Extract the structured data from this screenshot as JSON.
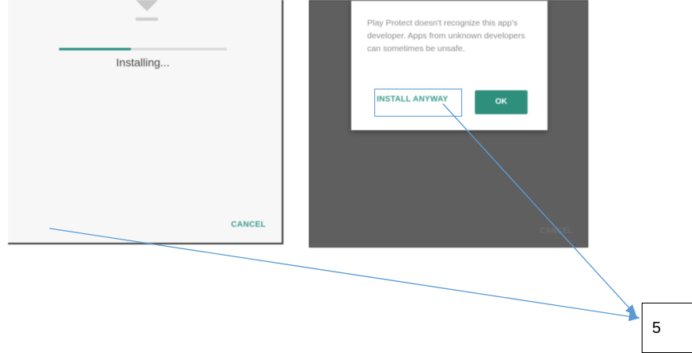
{
  "installing_screen": {
    "status_label": "Installing...",
    "progress_fraction": 0.43,
    "cancel_label": "CANCEL",
    "icon": "download-arrow-icon"
  },
  "play_protect_dialog": {
    "message": "Play Protect doesn't recognize this app's developer. Apps from unknown developers can sometimes be unsafe.",
    "install_anyway_label": "INSTALL ANYWAY",
    "ok_label": "OK",
    "background_cancel_label": "CANCEL"
  },
  "annotation": {
    "step_number": "5",
    "highlight_color": "#5b9bd5",
    "arrow_color": "#5b9bd5"
  },
  "colors": {
    "accent_teal": "#2f8f7d",
    "dim_overlay": "#5f5f5f"
  }
}
